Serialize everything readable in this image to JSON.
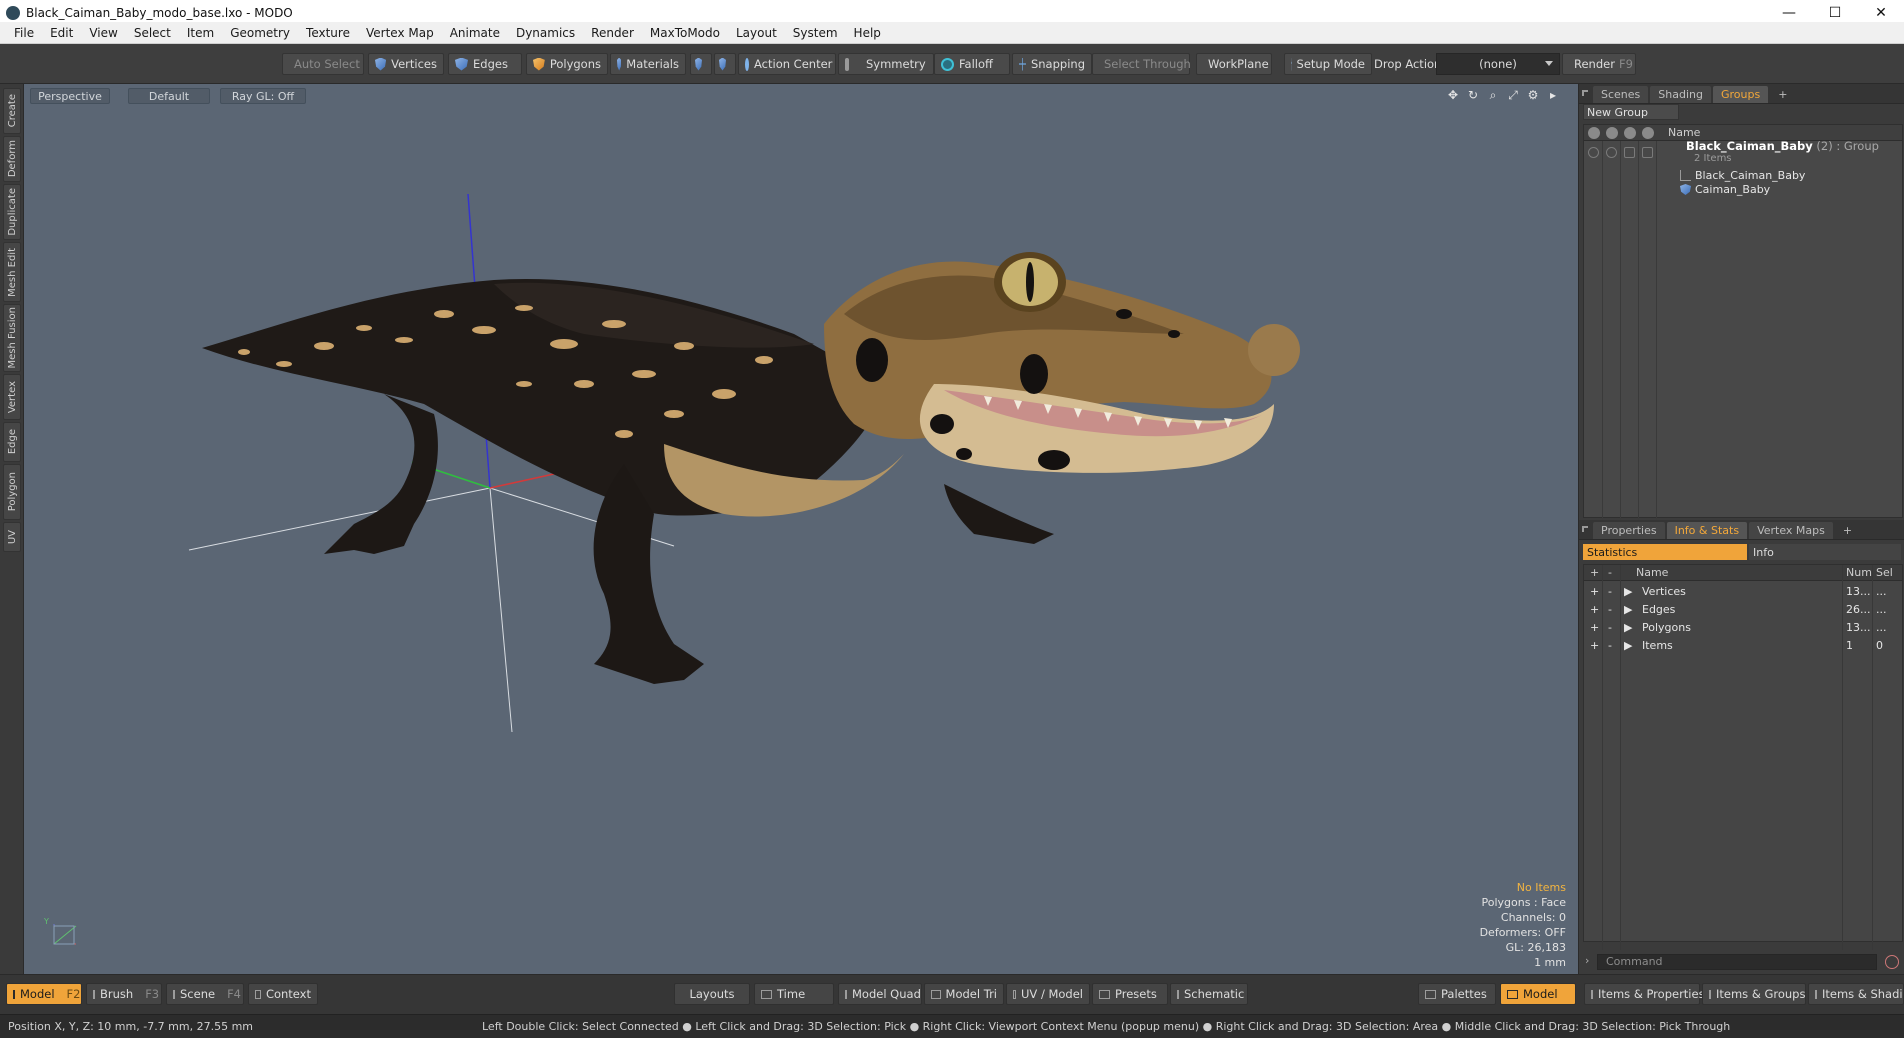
{
  "window": {
    "title": "Black_Caiman_Baby_modo_base.lxo - MODO",
    "minimize": "—",
    "maximize": "☐",
    "close": "✕"
  },
  "menu": [
    "File",
    "Edit",
    "View",
    "Select",
    "Item",
    "Geometry",
    "Texture",
    "Vertex Map",
    "Animate",
    "Dynamics",
    "Render",
    "MaxToModo",
    "Layout",
    "System",
    "Help"
  ],
  "toolbar": {
    "auto_select": "Auto Select",
    "vertices": "Vertices",
    "edges": "Edges",
    "polygons": "Polygons",
    "materials": "Materials",
    "action_center": "Action Center",
    "symmetry": "Symmetry",
    "falloff": "Falloff",
    "snapping": "Snapping",
    "select_through": "Select Through",
    "workplane": "WorkPlane",
    "setup_mode": "Setup Mode",
    "drop_action_label": "Drop Action",
    "drop_action_value": "(none)",
    "render": "Render",
    "render_key": "F9"
  },
  "left_tabs": [
    "Create",
    "Deform",
    "Duplicate",
    "Mesh Edit",
    "Mesh Fusion",
    "Vertex",
    "Edge",
    "Polygon",
    "UV"
  ],
  "viewport": {
    "view_type": "Perspective",
    "shading": "Default",
    "raygl": "Ray GL: Off",
    "info": {
      "selection": "No Items",
      "polygons": "Polygons : Face",
      "channels": "Channels: 0",
      "deformers": "Deformers: OFF",
      "gl": "GL: 26,183",
      "scale": "1 mm"
    },
    "axis_label": "Y"
  },
  "scene_panel": {
    "tabs": [
      "Scenes",
      "Shading",
      "Groups"
    ],
    "active_tab": "Groups",
    "new_group": "New Group",
    "column_name": "Name",
    "group": {
      "name": "Black_Caiman_Baby",
      "meta": " (2) : Group",
      "sub": "2 Items"
    },
    "children": [
      "Black_Caiman_Baby",
      "Caiman_Baby"
    ]
  },
  "props_panel": {
    "tabs": [
      "Properties",
      "Info & Stats",
      "Vertex Maps"
    ],
    "active_tab": "Info & Stats",
    "statistics": "Statistics",
    "info": "Info",
    "columns": {
      "add": "+",
      "remove": "-",
      "name": "Name",
      "num": "Num",
      "sel": "Sel"
    },
    "rows": [
      {
        "name": "Vertices",
        "num": "13...",
        "sel": "..."
      },
      {
        "name": "Edges",
        "num": "26...",
        "sel": "..."
      },
      {
        "name": "Polygons",
        "num": "13...",
        "sel": "..."
      },
      {
        "name": "Items",
        "num": "1",
        "sel": "0"
      }
    ],
    "command_placeholder": "Command"
  },
  "bottom": {
    "model": "Model",
    "model_key": "F2",
    "brush": "Brush",
    "brush_key": "F3",
    "scene": "Scene",
    "scene_key": "F4",
    "context": "Context",
    "layouts": "Layouts",
    "time": "Time",
    "model_quad": "Model Quad",
    "model_tri": "Model Tri",
    "uv_model": "UV / Model",
    "presets": "Presets",
    "schematic": "Schematic",
    "palettes": "Palettes",
    "model_right": "Model",
    "items_properties": "Items & Properties",
    "items_groups": "Items & Groups",
    "items_shading": "Items & Shading"
  },
  "status": {
    "position": "Position X, Y, Z:   10 mm, -7.7 mm, 27.55 mm",
    "hint": "Left Double Click: Select Connected ● Left Click and Drag: 3D Selection: Pick ● Right Click: Viewport Context Menu (popup menu) ● Right Click and Drag: 3D Selection: Area ● Middle Click and Drag: 3D Selection: Pick Through"
  },
  "colors": {
    "accent": "#f0a43a",
    "viewport_bg": "#5b6674",
    "panel_bg": "#3b3b3b"
  }
}
